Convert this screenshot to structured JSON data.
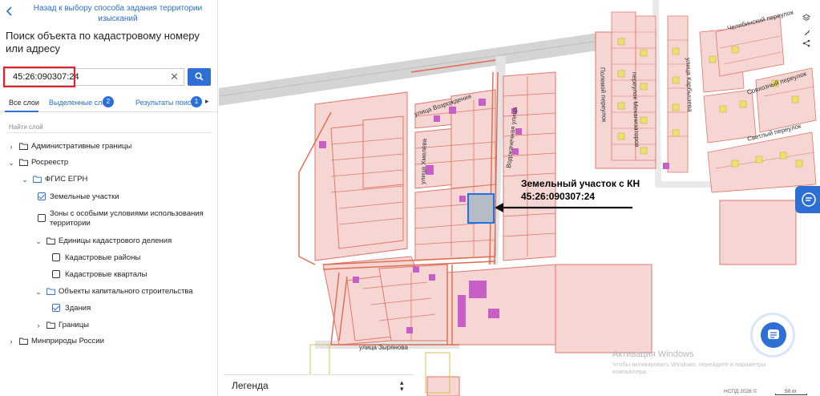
{
  "panel": {
    "back_link": "Назад к выбору способа задания территории изысканий",
    "title": "Поиск объекта по кадастровому номеру или адресу",
    "search": {
      "value": "45:26:090307:24",
      "placeholder": ""
    },
    "tabs": {
      "all": "Все слои",
      "selected": "Выделенные слои",
      "selected_count": "2",
      "results": "Результаты поиска",
      "results_count": "1"
    },
    "layer_search_placeholder": "Найти слой",
    "tree": [
      {
        "label": "Административные границы",
        "expanded": false
      },
      {
        "label": "Росреестр",
        "expanded": true
      },
      {
        "label": "ФГИС ЕГРН",
        "expanded": true
      },
      {
        "label": "Земельные участки",
        "checked": true
      },
      {
        "label": "Зоны с особыми условиями использования территории",
        "checked": false
      },
      {
        "label": "Единицы кадастрового деления",
        "expanded": true
      },
      {
        "label": "Кадастровые районы",
        "checked": false
      },
      {
        "label": "Кадастровые кварталы",
        "checked": false
      },
      {
        "label": "Объекты капитального строительства",
        "expanded": true
      },
      {
        "label": "Здания",
        "checked": true
      },
      {
        "label": "Границы",
        "expanded": false
      },
      {
        "label": "Минприроды России",
        "expanded": false
      }
    ],
    "legend": "Легенда"
  },
  "map": {
    "annotation": "Земельный участок с КН 45:26:090307:24",
    "streets": {
      "vozrozhdeniya": "улица Возрождения",
      "vodokachechnaya": "Водокачечная улица",
      "khmeleva": "улица Хмелёва",
      "zyryanova": "улица Зырянова",
      "polevoy": "Полевой переулок",
      "mekhanizatorov": "переулок Механизаторов",
      "karbysheva": "улица Карбышева",
      "chelyabinsky": "Челябинский переулок",
      "sovkhozny": "Совхозный переулок",
      "svetly": "Светлый переулок"
    },
    "watermark_title": "Активация Windows",
    "watermark_text": "Чтобы активировать Windows, перейдите в параметры компьютера.",
    "copyright": "НСПД 2026 ©",
    "scale": "50 m",
    "colors": {
      "parcel_fill": "#f6d6d2",
      "parcel_stroke": "#e0766c",
      "building": "#c85fc6",
      "selected_fill": "#b5bcc6",
      "selected_stroke": "#1a73e8",
      "road": "#d9d9d9",
      "accent": "#2e6fd6",
      "alert_outline": "#e0202a"
    }
  }
}
